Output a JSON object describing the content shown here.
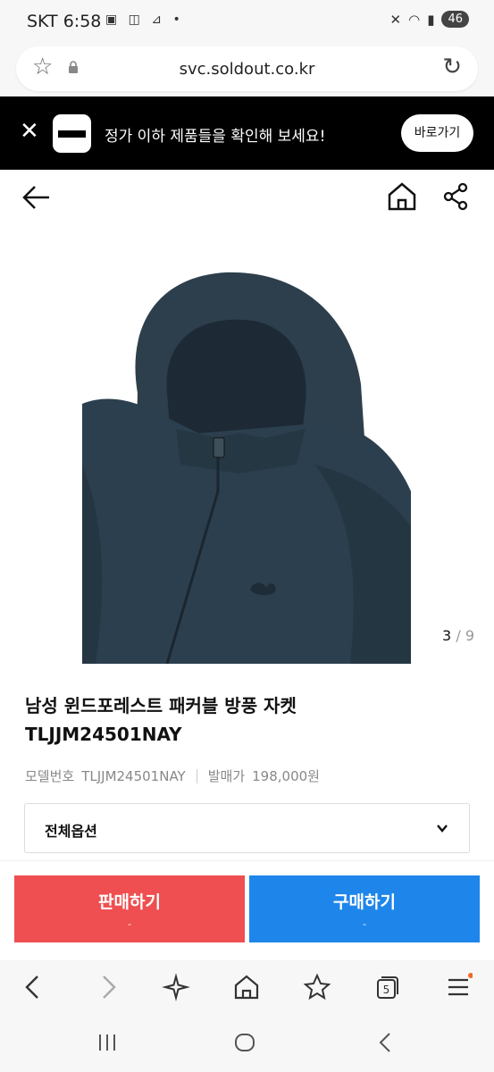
{
  "status_bar": {
    "carrier": "SKT",
    "time": "6:58",
    "battery": "46"
  },
  "browser": {
    "url": "svc.soldout.co.kr"
  },
  "banner": {
    "message": "정가 이하 제품들을 확인해 보세요!",
    "cta_label": "바로가기"
  },
  "product": {
    "image_counter": {
      "current": "3",
      "separator": "/",
      "total": "9"
    },
    "title_line1": "남성 윈드포레스트 패커블 방풍 자켓",
    "title_line2": "TLJJM24501NAY",
    "model_label": "모델번호",
    "model_number": "TLJJM24501NAY",
    "release_price_label": "발매가",
    "release_price": "198,000원",
    "options_label": "전체옵션"
  },
  "actions": {
    "sell_label": "판매하기",
    "sell_sub": "-",
    "buy_label": "구매하기",
    "buy_sub": "-"
  },
  "colors": {
    "sell": "#ef4f50",
    "buy": "#1e86ea",
    "banner_bg": "#000000",
    "jacket": "#2c3f4e"
  }
}
